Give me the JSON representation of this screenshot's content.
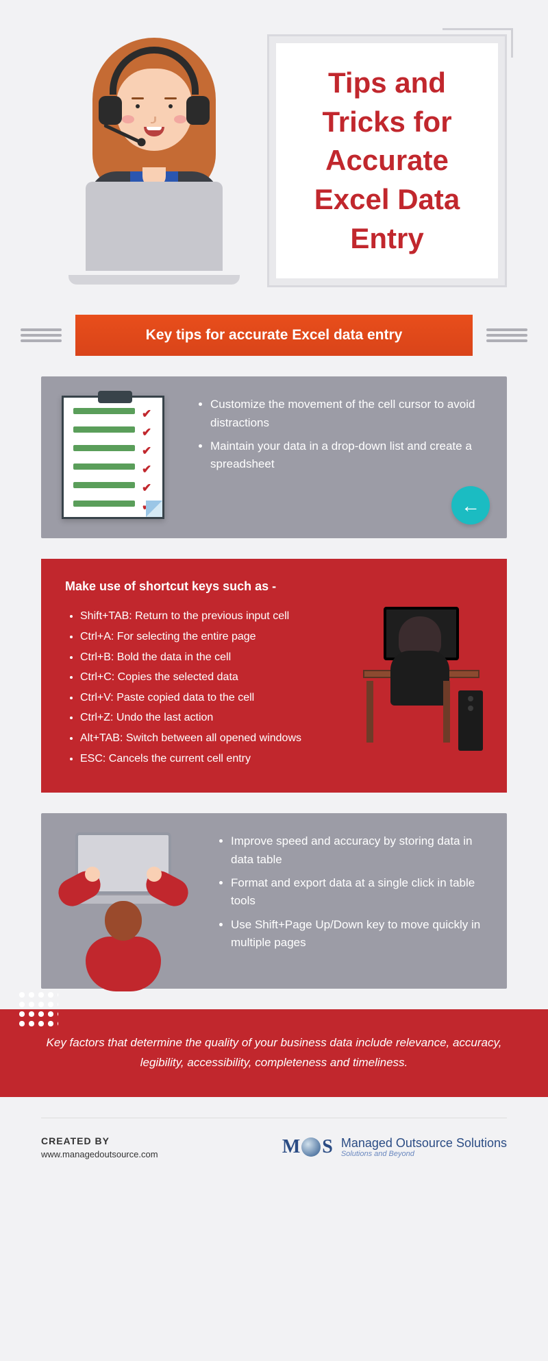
{
  "header": {
    "title": "Tips and Tricks for Accurate Excel Data Entry"
  },
  "banner": {
    "text": "Key tips for accurate Excel data entry"
  },
  "tipsCard1": {
    "items": [
      "Customize the movement of the cell cursor to avoid distractions",
      "Maintain your data in a drop-down list and create a spreadsheet"
    ]
  },
  "shortcutsCard": {
    "heading": "Make use of shortcut keys such as -",
    "items": [
      "Shift+TAB: Return to the previous input cell",
      "Ctrl+A: For selecting the entire page",
      "Ctrl+B: Bold the data in the cell",
      "Ctrl+C: Copies the selected data",
      "Ctrl+V: Paste copied data to the cell",
      "Ctrl+Z: Undo the last action",
      "Alt+TAB: Switch between all opened windows",
      "ESC: Cancels the current cell entry"
    ]
  },
  "tipsCard2": {
    "items": [
      "Improve speed and accuracy by storing data in data table",
      "Format and export data at a single click in table tools",
      "Use Shift+Page Up/Down key to move quickly in multiple pages"
    ]
  },
  "quote": {
    "text": "Key factors that determine the quality of your business data include relevance, accuracy, legibility, accessibility, completeness and timeliness."
  },
  "footer": {
    "createdLabel": "CREATED BY",
    "createdUrl": "www.managedoutsource.com",
    "brandPrefix": "M",
    "brandSuffix": "S",
    "brandName": "Managed Outsource Solutions",
    "brandTagline": "Solutions and Beyond"
  },
  "icons": {
    "arrowLeft": "←"
  }
}
